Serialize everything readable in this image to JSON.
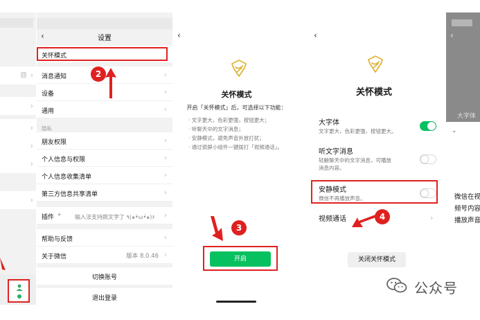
{
  "panel1": {
    "right_glyph": "回",
    "tab_me_icon": "person-icon"
  },
  "settings": {
    "title": "设置",
    "items": [
      {
        "label": "关怀模式"
      },
      {
        "label": "消息通知"
      },
      {
        "label": "设备"
      },
      {
        "label": "通用"
      }
    ],
    "privacy_section": "隐私",
    "privacy_items": [
      {
        "label": "朋友权限"
      },
      {
        "label": "个人信息与权限"
      },
      {
        "label": "个人信息收集清单"
      },
      {
        "label": "第三方信息共享清单"
      }
    ],
    "plugin_label": "插件",
    "plugin_hint": "输入法支持颜文字了 ٩(๑•̀ω•́๑)۶",
    "help_label": "帮助与反馈",
    "about_label": "关于微信",
    "about_version": "版本 8.0.46",
    "switch_account": "切换账号",
    "logout": "退出登录"
  },
  "care_intro": {
    "title": "关怀模式",
    "intro": "开启「关怀模式」后，可选择以下功能：",
    "features": [
      "· 文字更大，色彩更强，按钮更大；",
      "· 听聊天中的文字消息；",
      "· 安静模式，避免声音外放打扰；",
      "· 通过锁屏小组件一键拨打「视频通话」。"
    ],
    "enable_button": "开启"
  },
  "care_settings": {
    "title": "关怀模式",
    "options": [
      {
        "title": "大字体",
        "desc": "文字更大，色彩更强，按钮更大。",
        "on": true
      },
      {
        "title": "听文字消息",
        "desc": "轻触聊天中的文字消息，可播放\n消息内容。",
        "on": false
      },
      {
        "title": "安静模式",
        "desc": "微信不再播放声音。",
        "on": false
      }
    ],
    "video_call": "视频通话",
    "close_button": "关闭关怀模式"
  },
  "panel5": {
    "header_text": "大字体",
    "lines": [
      "微信在视",
      "频号内容",
      "播放声音"
    ]
  },
  "badges": [
    "2",
    "3",
    "4"
  ],
  "watermark": "公众号",
  "colors": {
    "accent_red": "#e02020",
    "wechat_green": "#07c160",
    "logo_gold": "#e0b43a"
  }
}
